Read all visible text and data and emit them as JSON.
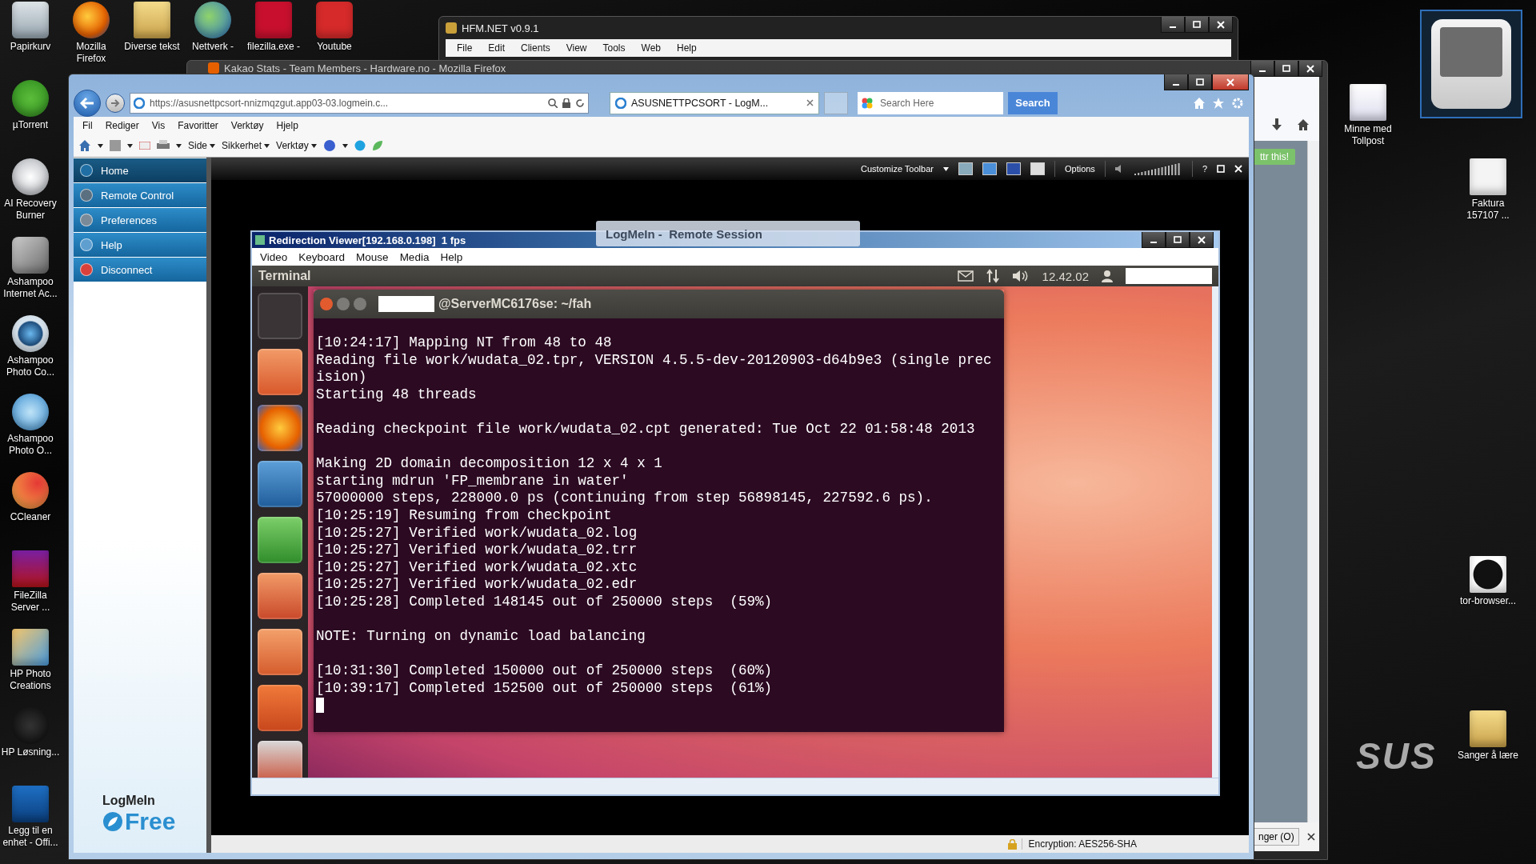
{
  "desktop": {
    "top_icons": [
      "Papirkurv",
      "Mozilla Firefox",
      "Diverse tekst",
      "Nettverk -",
      "filezilla.exe -",
      "Youtube"
    ],
    "left_icons": [
      "µTorrent",
      "AI Recovery Burner",
      "Ashampoo Internet Ac...",
      "Ashampoo Photo Co...",
      "Ashampoo Photo O...",
      "CCleaner",
      "FileZilla Server ...",
      "HP Photo Creations",
      "HP Løsning...",
      "Legg til en enhet - Offi..."
    ],
    "right_icons": [
      "Minne med Tollpost",
      "Faktura 157107 ...",
      "tor-browser...",
      "Sanger å lære"
    ],
    "wallpaper_logo": "SUS"
  },
  "hfm_window": {
    "title": "HFM.NET v0.9.1",
    "menu": [
      "File",
      "Edit",
      "Clients",
      "View",
      "Tools",
      "Web",
      "Help"
    ]
  },
  "firefox_window": {
    "title": "Kakao Stats - Team Members - Hardware.no - Mozilla Firefox",
    "side_button": "ttr this!",
    "bottom_button": "nger (O)"
  },
  "ie_window": {
    "address": "https://asusnettpcsort-nnizmqzgut.app03-03.logmein.c...",
    "tab": "ASUSNETTPCSORT - LogM...",
    "search": {
      "placeholder": "Search Here"
    },
    "search_button": "Search",
    "menu": [
      "Fil",
      "Rediger",
      "Vis",
      "Favoritter",
      "Verktøy",
      "Hjelp"
    ],
    "command_bar": [
      "Side",
      "Sikkerhet",
      "Verktøy"
    ],
    "status": "Encryption: AES256-SHA"
  },
  "logmein": {
    "nav": [
      {
        "label": "Home",
        "selected": true
      },
      {
        "label": "Remote Control",
        "selected": false
      },
      {
        "label": "Preferences",
        "selected": false
      },
      {
        "label": "Help",
        "selected": false
      },
      {
        "label": "Disconnect",
        "selected": false
      }
    ],
    "logo_top": "LogMeIn",
    "logo_bottom": "Free",
    "toolbar": {
      "customize": "Customize Toolbar",
      "options": "Options",
      "help": "?"
    },
    "overlay": "LogMeIn -  Remote Session"
  },
  "viewer": {
    "title": "Redirection Viewer[192.168.0.198]  1 fps",
    "menu": [
      "Video",
      "Keyboard",
      "Mouse",
      "Media",
      "Help"
    ]
  },
  "ubuntu": {
    "panel_title": "Terminal",
    "clock": "12.42.02",
    "terminal_title": "@ServerMC6176se: ~/fah",
    "blocks": [
      [
        "[10:24:17] Mapping NT from 48 to 48",
        "Reading file work/wudata_02.tpr, VERSION 4.5.5-dev-20120903-d64b9e3 (single prec",
        "ision)",
        "Starting 48 threads"
      ],
      [
        "Reading checkpoint file work/wudata_02.cpt generated: Tue Oct 22 01:58:48 2013"
      ],
      [
        "Making 2D domain decomposition 12 x 4 x 1",
        "starting mdrun 'FP_membrane in water'",
        "57000000 steps, 228000.0 ps (continuing from step 56898145, 227592.6 ps).",
        "[10:25:19] Resuming from checkpoint",
        "[10:25:27] Verified work/wudata_02.log",
        "[10:25:27] Verified work/wudata_02.trr",
        "[10:25:27] Verified work/wudata_02.xtc",
        "[10:25:27] Verified work/wudata_02.edr",
        "[10:25:28] Completed 148145 out of 250000 steps  (59%)"
      ],
      [
        "NOTE: Turning on dynamic load balancing"
      ],
      [
        "[10:31:30] Completed 150000 out of 250000 steps  (60%)",
        "[10:39:17] Completed 152500 out of 250000 steps  (61%)"
      ]
    ]
  }
}
